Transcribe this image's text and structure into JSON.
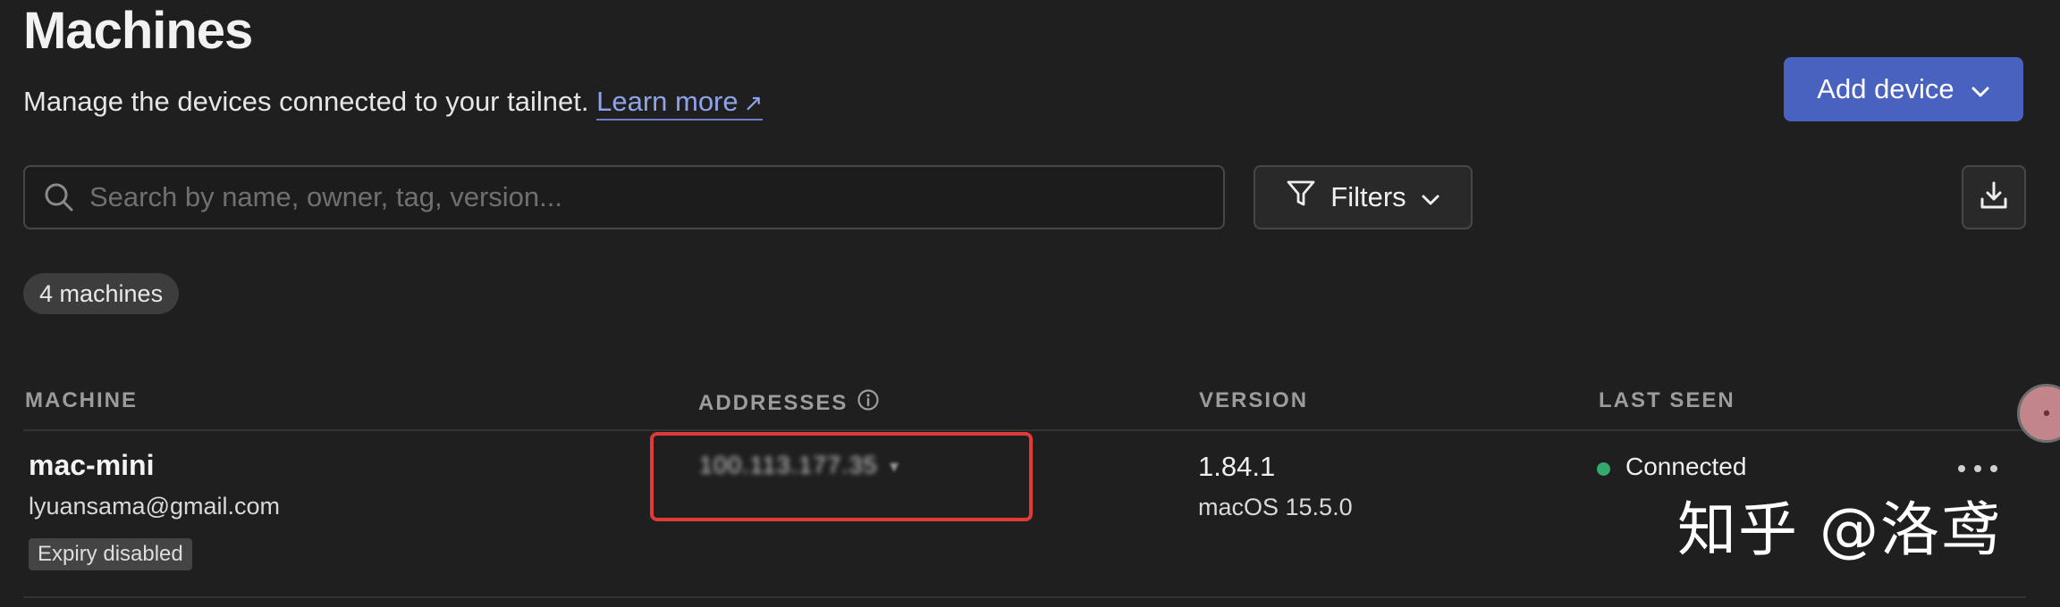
{
  "header": {
    "title": "Machines",
    "subtitle": "Manage the devices connected to your tailnet.",
    "learn_more": "Learn more",
    "learn_more_arrow": "↗",
    "add_device": "Add device"
  },
  "toolbar": {
    "search_placeholder": "Search by name, owner, tag, version...",
    "filters_label": "Filters"
  },
  "machines_count": "4 machines",
  "table": {
    "columns": [
      "MACHINE",
      "ADDRESSES",
      "VERSION",
      "LAST SEEN"
    ],
    "rows": [
      {
        "name": "mac-mini",
        "owner": "lyuansama@gmail.com",
        "badge": "Expiry disabled",
        "address": "100.113.177.35",
        "version": "1.84.1",
        "os": "macOS 15.5.0",
        "last_seen": "Connected"
      }
    ]
  },
  "watermark": "知乎 @洛鸢",
  "colors": {
    "accent": "#4a62bf",
    "link": "#8ea3e8",
    "connected": "#35a86b",
    "highlight": "#e03b36",
    "background": "#1f1f1f"
  },
  "icons": [
    "search-icon",
    "chevron-down-icon",
    "filter-icon",
    "download-icon",
    "info-icon",
    "more-icon"
  ]
}
